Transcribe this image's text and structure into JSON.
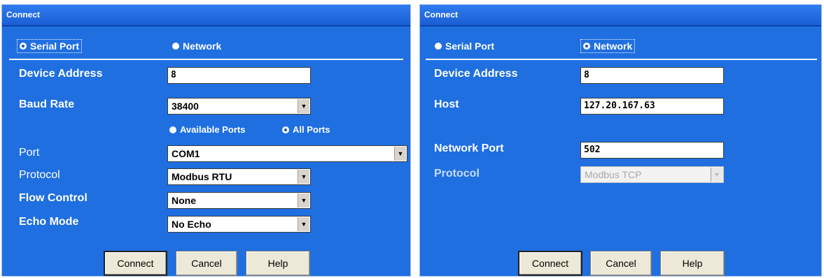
{
  "left": {
    "title": "Connect",
    "mode_serial": "Serial Port",
    "mode_network": "Network",
    "device_address_label": "Device Address",
    "device_address_value": "8",
    "baud_rate_label": "Baud Rate",
    "baud_rate_value": "38400",
    "available_ports": "Available Ports",
    "all_ports": "All Ports",
    "port_label": "Port",
    "port_value": "COM1",
    "protocol_label": "Protocol",
    "protocol_value": "Modbus RTU",
    "flow_control_label": "Flow Control",
    "flow_control_value": "None",
    "echo_mode_label": "Echo Mode",
    "echo_mode_value": "No Echo",
    "connect_btn": "Connect",
    "cancel_btn": "Cancel",
    "help_btn": "Help"
  },
  "right": {
    "title": "Connect",
    "mode_serial": "Serial Port",
    "mode_network": "Network",
    "device_address_label": "Device Address",
    "device_address_value": "8",
    "host_label": "Host",
    "host_value": "127.20.167.63",
    "network_port_label": "Network Port",
    "network_port_value": "502",
    "protocol_label": "Protocol",
    "protocol_value": "Modbus TCP",
    "connect_btn": "Connect",
    "cancel_btn": "Cancel",
    "help_btn": "Help"
  },
  "icons": {
    "dropdown_arrow": "chevron-down-icon",
    "radio": "radio-button-icon"
  },
  "colors": {
    "dialog_background": "#1f6fe0",
    "title_bar": "#1a5ed3"
  }
}
